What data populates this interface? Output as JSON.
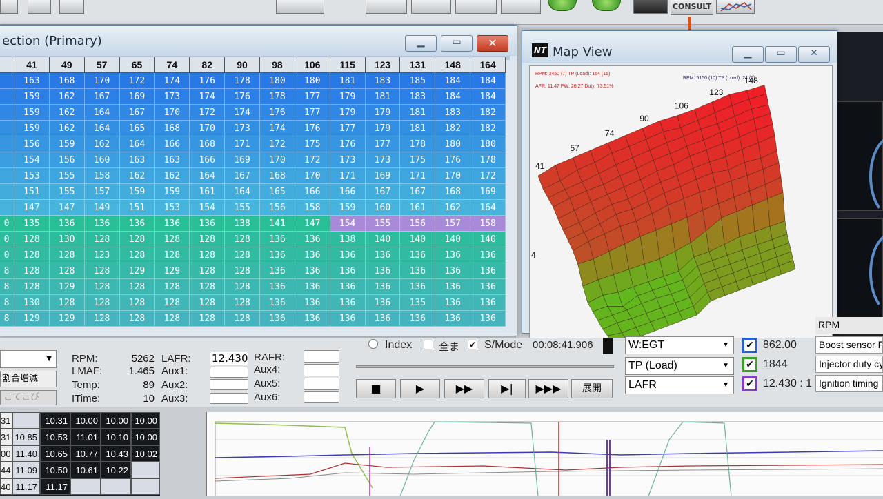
{
  "toolbar": {
    "consult_label": "CONSULT"
  },
  "fuel_window": {
    "title": "ection (Primary)",
    "col_headers": [
      "41",
      "49",
      "57",
      "65",
      "74",
      "82",
      "90",
      "98",
      "106",
      "115",
      "123",
      "131",
      "148",
      "164"
    ],
    "row_label_fragments": [
      "",
      "",
      "",
      "",
      "",
      "",
      "",
      "",
      "",
      "0",
      "0",
      "0",
      "8",
      "8",
      "8",
      "8"
    ],
    "rows": [
      [
        "163",
        "168",
        "170",
        "172",
        "174",
        "176",
        "178",
        "180",
        "180",
        "181",
        "183",
        "185",
        "184",
        "184"
      ],
      [
        "159",
        "162",
        "167",
        "169",
        "173",
        "174",
        "176",
        "178",
        "177",
        "179",
        "181",
        "183",
        "184",
        "184"
      ],
      [
        "159",
        "162",
        "164",
        "167",
        "170",
        "172",
        "174",
        "176",
        "177",
        "179",
        "179",
        "181",
        "183",
        "182"
      ],
      [
        "159",
        "162",
        "164",
        "165",
        "168",
        "170",
        "173",
        "174",
        "176",
        "177",
        "179",
        "181",
        "182",
        "182"
      ],
      [
        "156",
        "159",
        "162",
        "164",
        "166",
        "168",
        "171",
        "172",
        "175",
        "176",
        "177",
        "178",
        "180",
        "180"
      ],
      [
        "154",
        "156",
        "160",
        "163",
        "163",
        "166",
        "169",
        "170",
        "172",
        "173",
        "173",
        "175",
        "176",
        "178"
      ],
      [
        "153",
        "155",
        "158",
        "162",
        "162",
        "164",
        "167",
        "168",
        "170",
        "171",
        "169",
        "171",
        "170",
        "172"
      ],
      [
        "151",
        "155",
        "157",
        "159",
        "159",
        "161",
        "164",
        "165",
        "166",
        "166",
        "167",
        "167",
        "168",
        "169"
      ],
      [
        "147",
        "147",
        "149",
        "151",
        "153",
        "154",
        "155",
        "156",
        "158",
        "159",
        "160",
        "161",
        "162",
        "164"
      ],
      [
        "135",
        "136",
        "136",
        "136",
        "136",
        "136",
        "138",
        "141",
        "147",
        "154",
        "155",
        "156",
        "157",
        "158"
      ],
      [
        "128",
        "130",
        "128",
        "128",
        "128",
        "128",
        "128",
        "136",
        "136",
        "138",
        "140",
        "140",
        "140",
        "140"
      ],
      [
        "128",
        "128",
        "123",
        "128",
        "128",
        "128",
        "128",
        "136",
        "136",
        "136",
        "136",
        "136",
        "136",
        "136"
      ],
      [
        "128",
        "128",
        "128",
        "129",
        "129",
        "128",
        "128",
        "136",
        "136",
        "136",
        "136",
        "136",
        "136",
        "136"
      ],
      [
        "128",
        "129",
        "128",
        "128",
        "128",
        "128",
        "128",
        "136",
        "136",
        "136",
        "136",
        "136",
        "136",
        "136"
      ],
      [
        "130",
        "128",
        "128",
        "128",
        "128",
        "128",
        "128",
        "136",
        "136",
        "136",
        "136",
        "135",
        "136",
        "136"
      ],
      [
        "129",
        "129",
        "128",
        "128",
        "128",
        "128",
        "128",
        "136",
        "136",
        "136",
        "136",
        "136",
        "136",
        "136"
      ]
    ]
  },
  "map_window": {
    "logo": "NT",
    "title": "Map View",
    "info": {
      "line1_left": "RPM: 3450 (7)  TP (Load): 164 (15)",
      "line1_right": "RPM: 5150 (10)  TP (Load): 24 (0)",
      "line2": "AFR: 11.47  PW: 26.27  Duty: 73.51%"
    },
    "axis_labels": [
      "4",
      "41",
      "57",
      "74",
      "90",
      "106",
      "123",
      "148"
    ]
  },
  "status": {
    "rpm_label": "RPM:",
    "rpm_value": "5262",
    "lmaf_label": "LMAF:",
    "lmaf_value": "1.465",
    "temp_label": "Temp:",
    "temp_value": "89",
    "itime_label": "ITime:",
    "itime_value": "10",
    "lafr_label": "LAFR:",
    "lafr_value": "12.430",
    "aux1_label": "Aux1:",
    "aux2_label": "Aux2:",
    "aux3_label": "Aux3:",
    "rafr_label": "RAFR:",
    "aux4_label": "Aux4:",
    "aux5_label": "Aux5:",
    "aux6_label": "Aux6:",
    "left_btn1": "割合増減",
    "left_btn2": "こてこび",
    "index_label": "Index",
    "all_label": "全ま",
    "smode_label": "S/Mode",
    "time": "00:08:41.906",
    "expand_label": "展開"
  },
  "selectors": [
    {
      "label": "W:EGT",
      "value": "862.00",
      "color": "#2a5fd0"
    },
    {
      "label": "TP (Load)",
      "value": "1844",
      "color": "#3aa02a"
    },
    {
      "label": "LAFR",
      "value": "12.430 : 1",
      "color": "#8a3ac8"
    }
  ],
  "side_labels": [
    "RPM",
    "Boost sensor F",
    "Injector duty cy",
    "Ignition timing"
  ],
  "bottom_table": [
    [
      "31",
      "",
      "10.31",
      "10.00",
      "10.00",
      "10.00"
    ],
    [
      "31",
      "10.85",
      "10.53",
      "11.01",
      "10.10",
      "10.00"
    ],
    [
      "00",
      "11.40",
      "10.65",
      "10.77",
      "10.43",
      "10.02"
    ],
    [
      "44",
      "11.09",
      "10.50",
      "10.61",
      "10.22",
      ""
    ],
    [
      "40",
      "11.17",
      "11.17",
      "",
      "",
      ""
    ]
  ]
}
